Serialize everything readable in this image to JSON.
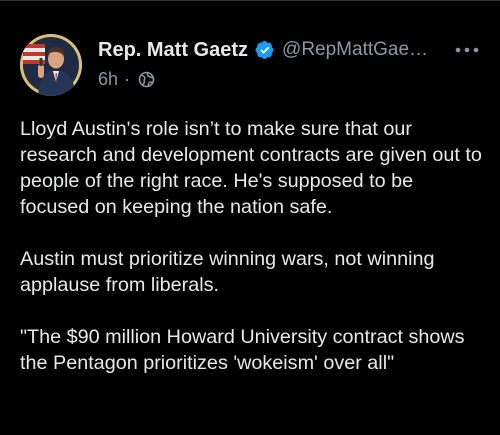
{
  "author": {
    "display_name": "Rep. Matt Gaetz",
    "handle": "@RepMattGae…",
    "verified_icon": "verified-badge-icon",
    "avatar_icon": "profile-photo"
  },
  "meta": {
    "time_ago": "6h",
    "separator": "·",
    "visibility_icon": "globe-icon"
  },
  "menu": {
    "icon": "more-options-icon"
  },
  "tweet": {
    "paragraphs": [
      "Lloyd Austin's role isn’t to make sure that our research and development contracts are given out to people of the right race. He's supposed to be focused on keeping the nation safe.",
      "Austin must prioritize winning wars, not winning applause from liberals.",
      "\"The $90 million Howard University contract shows the Pentagon prioritizes 'wokeism' over all\""
    ]
  },
  "colors": {
    "background": "#000000",
    "text": "#e7e9ea",
    "secondary": "#8b98a5",
    "verified": "#1d9bf0",
    "avatar_ring": "#d9c072"
  }
}
